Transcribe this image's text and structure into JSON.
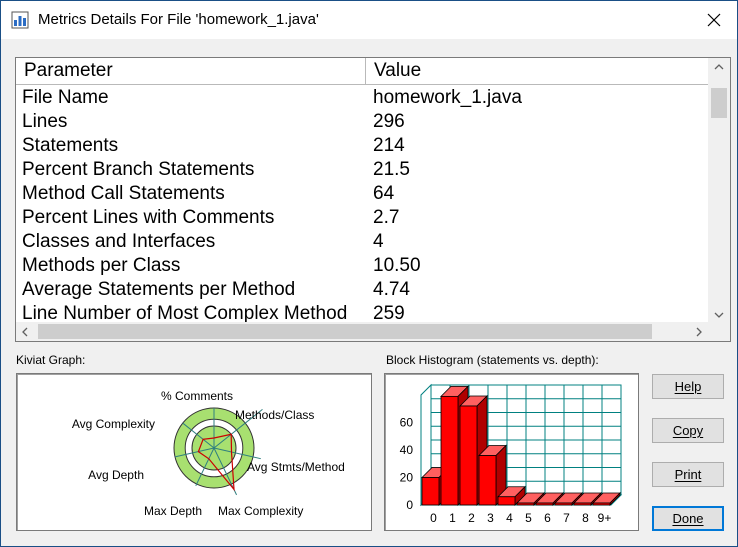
{
  "window": {
    "title": "Metrics Details For File 'homework_1.java'",
    "close_icon": "close-icon"
  },
  "table": {
    "headers": [
      "Parameter",
      "Value"
    ],
    "rows": [
      [
        "File Name",
        "homework_1.java"
      ],
      [
        "Lines",
        "296"
      ],
      [
        "Statements",
        "214"
      ],
      [
        "Percent Branch Statements",
        "21.5"
      ],
      [
        "Method Call Statements",
        "64"
      ],
      [
        "Percent Lines with Comments",
        "2.7"
      ],
      [
        "Classes and Interfaces",
        "4"
      ],
      [
        "Methods per Class",
        "10.50"
      ],
      [
        "Average Statements per Method",
        "4.74"
      ],
      [
        "Line Number of Most Complex Method",
        "259"
      ]
    ]
  },
  "kiviat": {
    "label": "Kiviat Graph:",
    "axes": [
      "% Comments",
      "Methods/Class",
      "Avg Stmts/Method",
      "Max Complexity",
      "Max Depth",
      "Avg Depth",
      "Avg Complexity"
    ],
    "ring_colors": {
      "outer": "#a8e070",
      "band": "#ffffff",
      "inner": "#a8e070",
      "polygon": "#cc0000"
    },
    "values": [
      0.25,
      0.55,
      0.45,
      1.15,
      0.3,
      0.4,
      0.35
    ]
  },
  "histogram": {
    "label": "Block Histogram (statements vs. depth):",
    "bar_color": "#ff0000",
    "grid_color": "#008080"
  },
  "chart_data": {
    "type": "bar",
    "title": "Block Histogram (statements vs. depth):",
    "categories": [
      "0",
      "1",
      "2",
      "3",
      "4",
      "5",
      "6",
      "7",
      "8",
      "9+"
    ],
    "values": [
      20,
      79,
      72,
      36,
      6,
      1,
      1,
      1,
      1,
      1
    ],
    "yticks": [
      "0",
      "20",
      "40",
      "60"
    ],
    "ylim": [
      0,
      80
    ],
    "grid": true
  },
  "buttons": {
    "help": "Help",
    "copy": "Copy",
    "print": "Print",
    "done": "Done"
  }
}
